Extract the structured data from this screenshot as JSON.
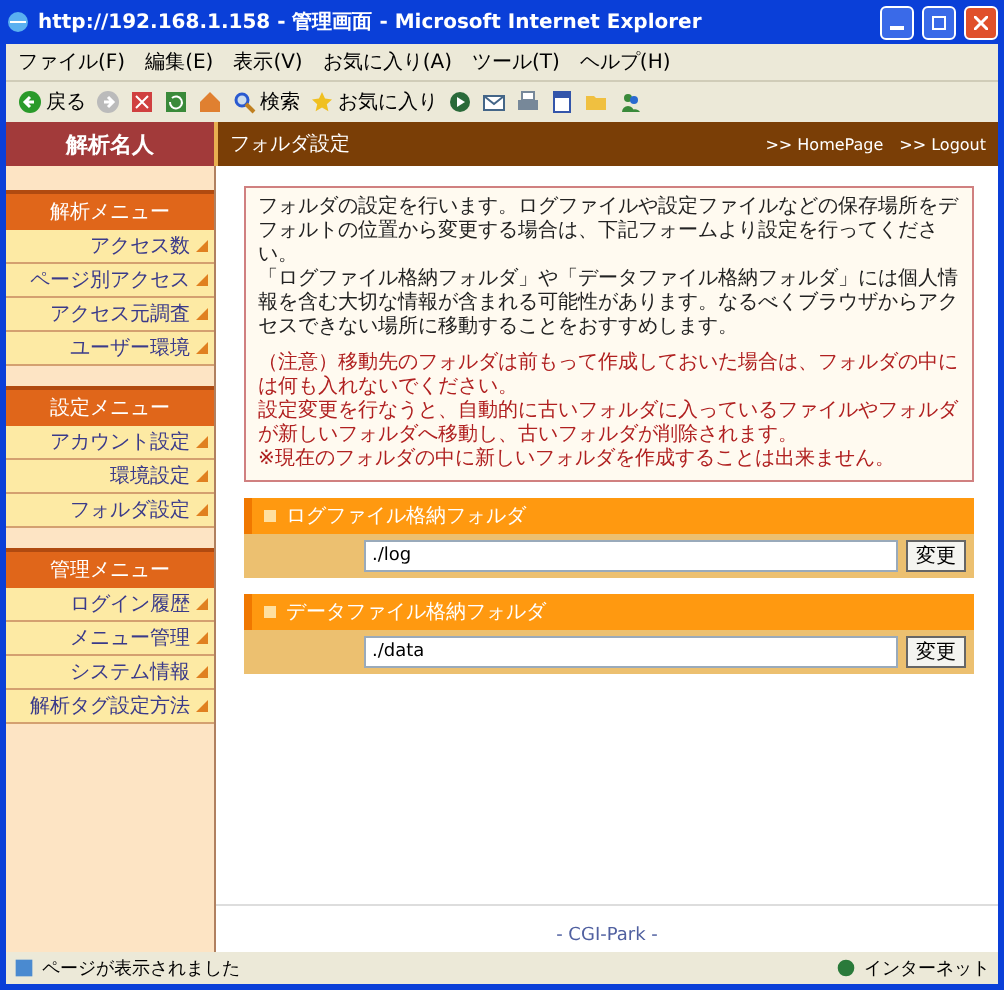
{
  "window": {
    "title": "http://192.168.1.158 - 管理画面 - Microsoft Internet Explorer"
  },
  "menu_bar": [
    "ファイル(F)",
    "編集(E)",
    "表示(V)",
    "お気に入り(A)",
    "ツール(T)",
    "ヘルプ(H)"
  ],
  "toolbar": [
    {
      "kind": "back",
      "label": "戻る"
    },
    {
      "kind": "forward"
    },
    {
      "kind": "stop"
    },
    {
      "kind": "refresh"
    },
    {
      "kind": "home"
    },
    {
      "kind": "search",
      "label": "検索"
    },
    {
      "kind": "favorites",
      "label": "お気に入り"
    },
    {
      "kind": "media"
    },
    {
      "kind": "mail"
    },
    {
      "kind": "print"
    },
    {
      "kind": "edit"
    },
    {
      "kind": "folder"
    },
    {
      "kind": "messenger"
    }
  ],
  "app": {
    "name": "解析名人",
    "page_title": "フォルダ設定",
    "links": [
      ">> HomePage",
      ">> Logout"
    ]
  },
  "sidebar": [
    {
      "title": "解析メニュー",
      "items": [
        "アクセス数",
        "ページ別アクセス",
        "アクセス元調査",
        "ユーザー環境"
      ]
    },
    {
      "title": "設定メニュー",
      "items": [
        "アカウント設定",
        "環境設定",
        "フォルダ設定"
      ]
    },
    {
      "title": "管理メニュー",
      "items": [
        "ログイン履歴",
        "メニュー管理",
        "システム情報",
        "解析タグ設定方法"
      ]
    }
  ],
  "notice": {
    "paragraphs": [
      "フォルダの設定を行います。ログファイルや設定ファイルなどの保存場所をデフォルトの位置から変更する場合は、下記フォームより設定を行ってください。",
      "「ログファイル格納フォルダ」や「データファイル格納フォルダ」には個人情報を含む大切な情報が含まれる可能性があります。なるべくブラウザからアクセスできない場所に移動することをおすすめします。"
    ],
    "warnings": [
      "（注意）移動先のフォルダは前もって作成しておいた場合は、フォルダの中には何も入れないでください。",
      "設定変更を行なうと、自動的に古いフォルダに入っているファイルやフォルダが新しいフォルダへ移動し、古いフォルダが削除されます。",
      "※現在のフォルダの中に新しいフォルダを作成することは出来ません。"
    ]
  },
  "folders": [
    {
      "label": "ログファイル格納フォルダ",
      "value": "./log",
      "button": "変更"
    },
    {
      "label": "データファイル格納フォルダ",
      "value": "./data",
      "button": "変更"
    }
  ],
  "footer": "- CGI-Park -",
  "status_bar": {
    "text": "ページが表示されました",
    "zone": "インターネット"
  }
}
